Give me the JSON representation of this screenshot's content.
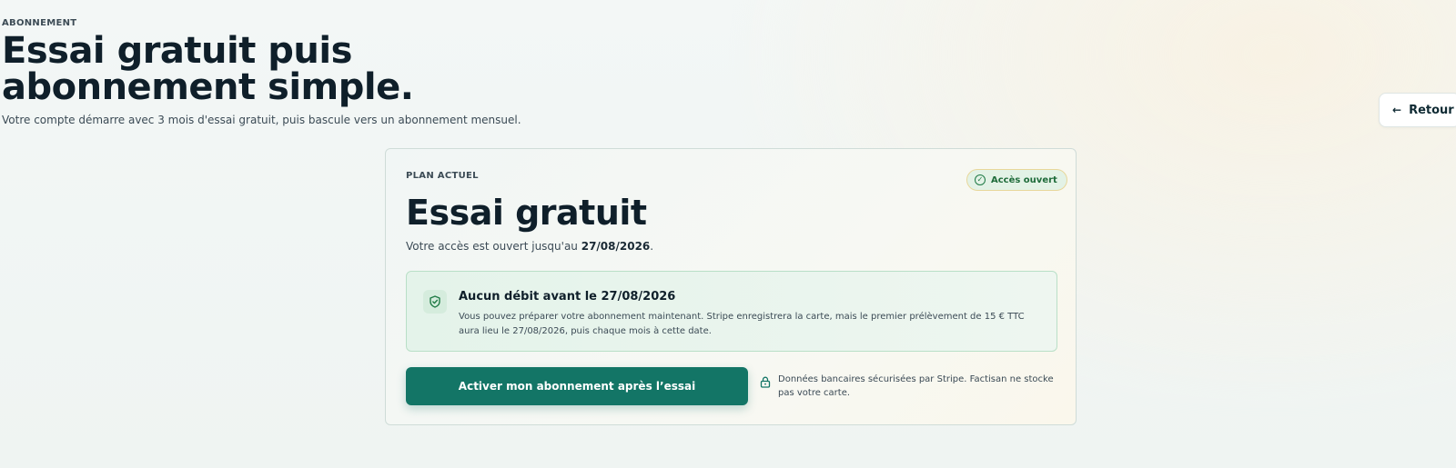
{
  "header": {
    "eyebrow": "ABONNEMENT",
    "title": "Essai gratuit puis abonnement simple.",
    "subtitle": "Votre compte démarre avec 3 mois d'essai gratuit, puis bascule vers un abonnement mensuel."
  },
  "back": {
    "label": "Retour",
    "icon": "arrow-left-icon"
  },
  "plan": {
    "label": "PLAN ACTUEL",
    "name": "Essai gratuit",
    "access_prefix": "Votre accès est ouvert jusqu'au ",
    "access_date": "27/08/2026",
    "access_suffix": ".",
    "badge": "Accès ouvert",
    "badge_icon": "check-circle-icon"
  },
  "notice": {
    "icon": "shield-check-icon",
    "title": "Aucun débit avant le 27/08/2026",
    "body": "Vous pouvez préparer votre abonnement maintenant. Stripe enregistrera la carte, mais le premier prélèvement de 15 € TTC aura lieu le 27/08/2026, puis chaque mois à cette date."
  },
  "actions": {
    "activate_label": "Activer mon abonnement après l’essai",
    "secure_text": "Données bancaires sécurisées par Stripe. Factisan ne stocke pas votre carte.",
    "secure_icon": "lock-icon"
  },
  "colors": {
    "accent": "#137566",
    "success": "#1f7a45",
    "text": "#0f1f2a"
  }
}
